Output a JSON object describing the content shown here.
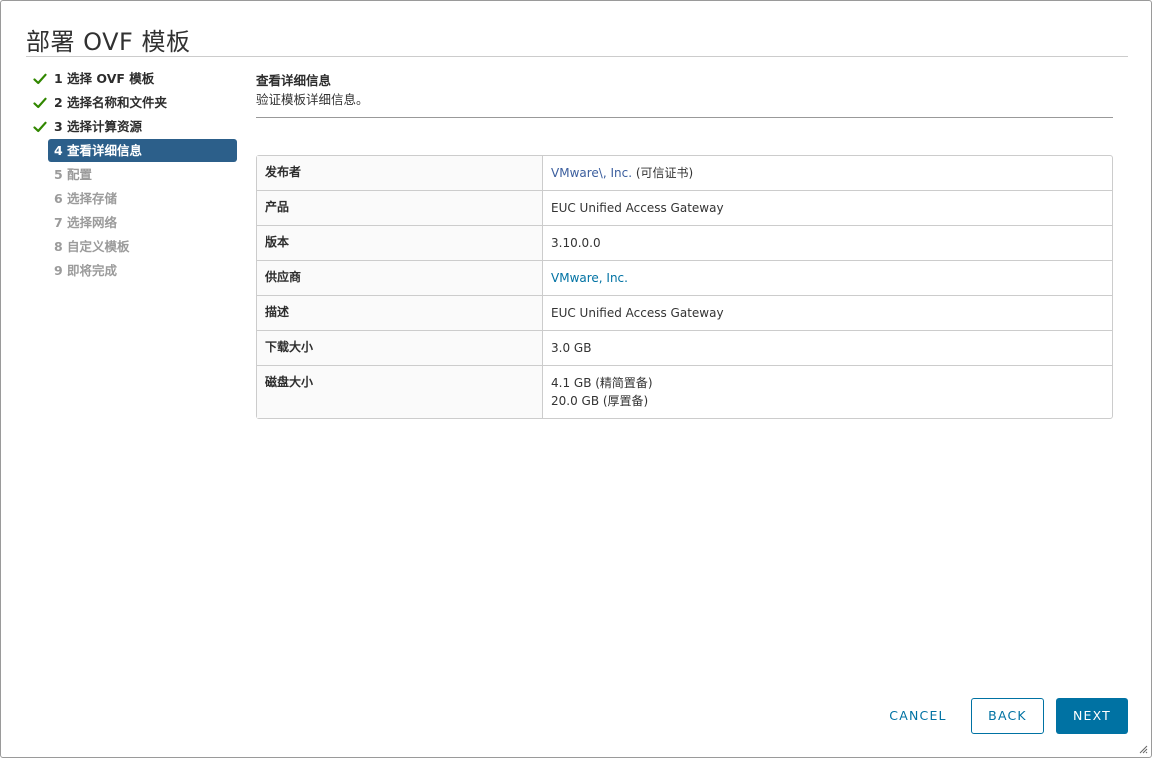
{
  "dialog": {
    "title": "部署 OVF 模板"
  },
  "steps": [
    {
      "label": "1 选择 OVF 模板",
      "state": "done"
    },
    {
      "label": "2 选择名称和文件夹",
      "state": "done"
    },
    {
      "label": "3 选择计算资源",
      "state": "done"
    },
    {
      "label": "4 查看详细信息",
      "state": "active"
    },
    {
      "label": "5 配置",
      "state": "disabled"
    },
    {
      "label": "6 选择存储",
      "state": "disabled"
    },
    {
      "label": "7 选择网络",
      "state": "disabled"
    },
    {
      "label": "8 自定义模板",
      "state": "disabled"
    },
    {
      "label": "9 即将完成",
      "state": "disabled"
    }
  ],
  "content": {
    "heading": "查看详细信息",
    "subheading": "验证模板详细信息。"
  },
  "details": {
    "publisher_label": "发布者",
    "publisher_link": "VMware\\, Inc.",
    "publisher_note": " (可信证书)",
    "product_label": "产品",
    "product_value": "EUC Unified Access Gateway",
    "version_label": "版本",
    "version_value": "3.10.0.0",
    "vendor_label": "供应商",
    "vendor_value": "VMware, Inc.",
    "description_label": "描述",
    "description_value": "EUC Unified Access Gateway",
    "download_size_label": "下载大小",
    "download_size_value": "3.0 GB",
    "disk_size_label": "磁盘大小",
    "disk_size_thin": "4.1 GB (精简置备)",
    "disk_size_thick": "20.0 GB (厚置备)"
  },
  "footer": {
    "cancel_label": "CANCEL",
    "back_label": "BACK",
    "next_label": "NEXT"
  },
  "colors": {
    "accent": "#0072a3",
    "active_step": "#2c5f8a",
    "check_green": "#318700"
  },
  "icons": {
    "step_done": "check-icon",
    "resize": "resize-grip-icon"
  }
}
